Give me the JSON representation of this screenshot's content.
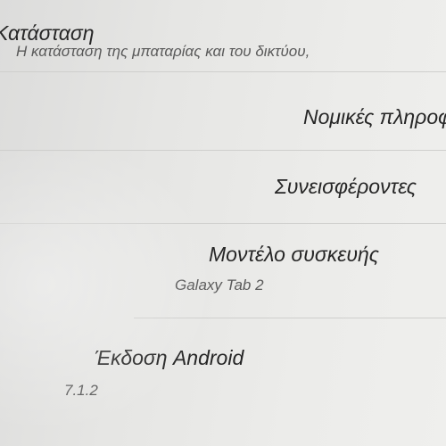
{
  "settings": {
    "status": {
      "title": "Κατάσταση",
      "summary": "Η κατάσταση της μπαταρίας και του δικτύου,"
    },
    "legal": {
      "title": "Νομικές πληροφορίες"
    },
    "contributors": {
      "title": "Συνεισφέροντες"
    },
    "model": {
      "title": "Μοντέλο συσκευής",
      "value": "Galaxy Tab 2"
    },
    "android_version": {
      "title": "Έκδοση Android",
      "value": "7.1.2"
    }
  }
}
